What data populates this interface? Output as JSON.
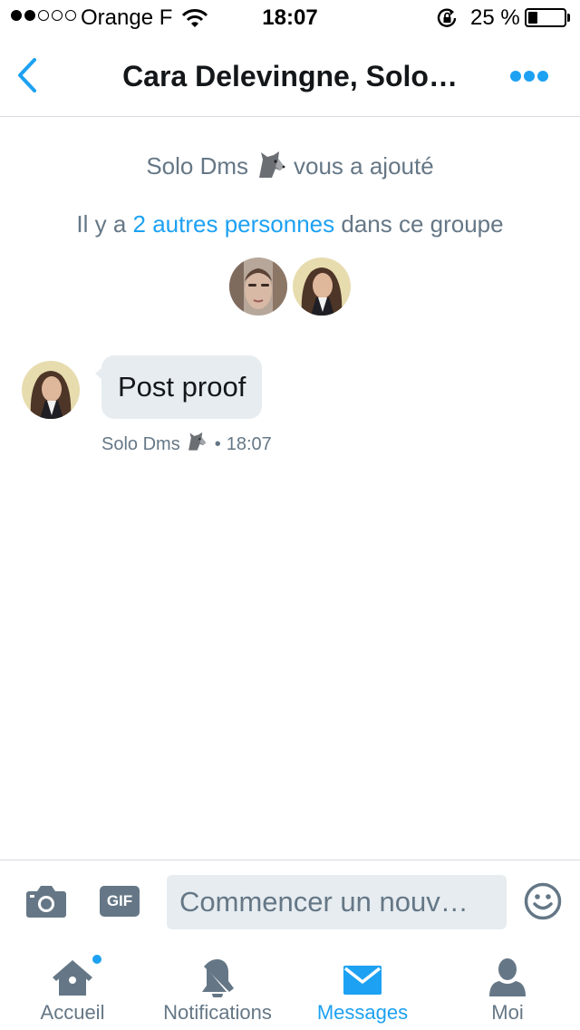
{
  "status_bar": {
    "carrier": "Orange F",
    "time": "18:07",
    "battery_text": "25 %",
    "battery_level": 0.25
  },
  "header": {
    "title": "Cara Delevingne, Solo…"
  },
  "conversation": {
    "added_by_name": "Solo Dms",
    "added_suffix": "vous a ajouté",
    "group_prefix": "Il y a",
    "group_link": "2 autres personnes",
    "group_suffix": "dans ce groupe",
    "message": {
      "text": "Post proof",
      "sender": "Solo Dms",
      "time": "18:07"
    }
  },
  "composer": {
    "gif_label": "GIF",
    "placeholder": "Commencer un nouv…"
  },
  "tabs": [
    {
      "label": "Accueil",
      "icon": "home-icon",
      "active": false,
      "badge": true
    },
    {
      "label": "Notifications",
      "icon": "bell-icon",
      "active": false,
      "badge": false
    },
    {
      "label": "Messages",
      "icon": "envelope-icon",
      "active": true,
      "badge": false
    },
    {
      "label": "Moi",
      "icon": "person-icon",
      "active": false,
      "badge": false
    }
  ],
  "colors": {
    "accent": "#1da1f2",
    "secondary_text": "#657786",
    "bubble": "#e6ecf0"
  }
}
